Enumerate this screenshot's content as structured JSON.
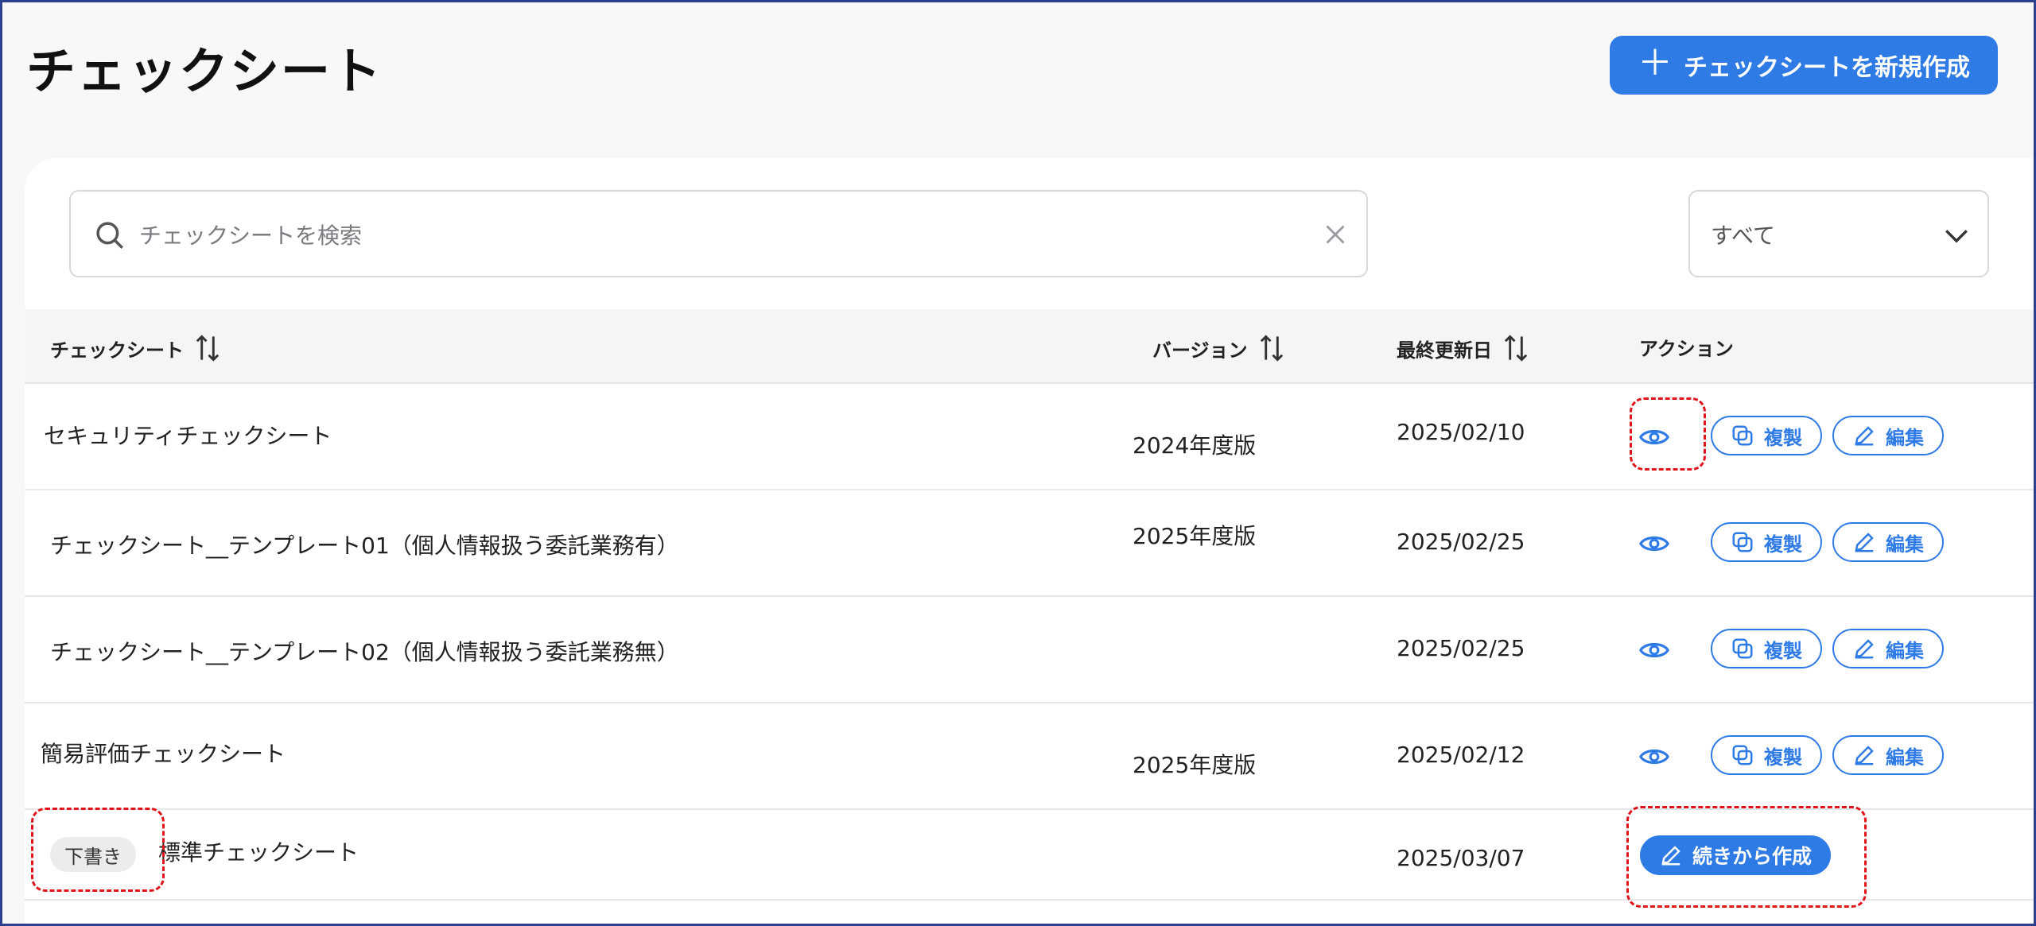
{
  "page": {
    "title": "チェックシート",
    "create_button_label": "チェックシートを新規作成"
  },
  "search": {
    "placeholder": "チェックシートを検索",
    "value": ""
  },
  "filter": {
    "selected": "すべて"
  },
  "table": {
    "columns": [
      "チェックシート",
      "バージョン",
      "最終更新日",
      "アクション"
    ],
    "rows": [
      {
        "name": "セキュリティチェックシート",
        "version": "2024年度版",
        "updated": "2025/02/10"
      },
      {
        "name": "チェックシート__テンプレート01（個人情報扱う委託業務有）",
        "version": "2025年度版",
        "updated": "2025/02/25"
      },
      {
        "name": "チェックシート__テンプレート02（個人情報扱う委託業務無）",
        "version": "",
        "updated": "2025/02/25"
      },
      {
        "name": "簡易評価チェックシート",
        "version": "2025年度版",
        "updated": "2025/02/12"
      },
      {
        "name": "標準チェックシート",
        "version": "",
        "updated": "2025/03/07",
        "badge": "下書き"
      }
    ]
  },
  "actions": {
    "duplicate_label": "複製",
    "edit_label": "編集",
    "continue_label": "続きから作成"
  },
  "colors": {
    "accent": "#2f7be6",
    "highlight": "#e0151b",
    "frame": "#2c3e8f"
  }
}
